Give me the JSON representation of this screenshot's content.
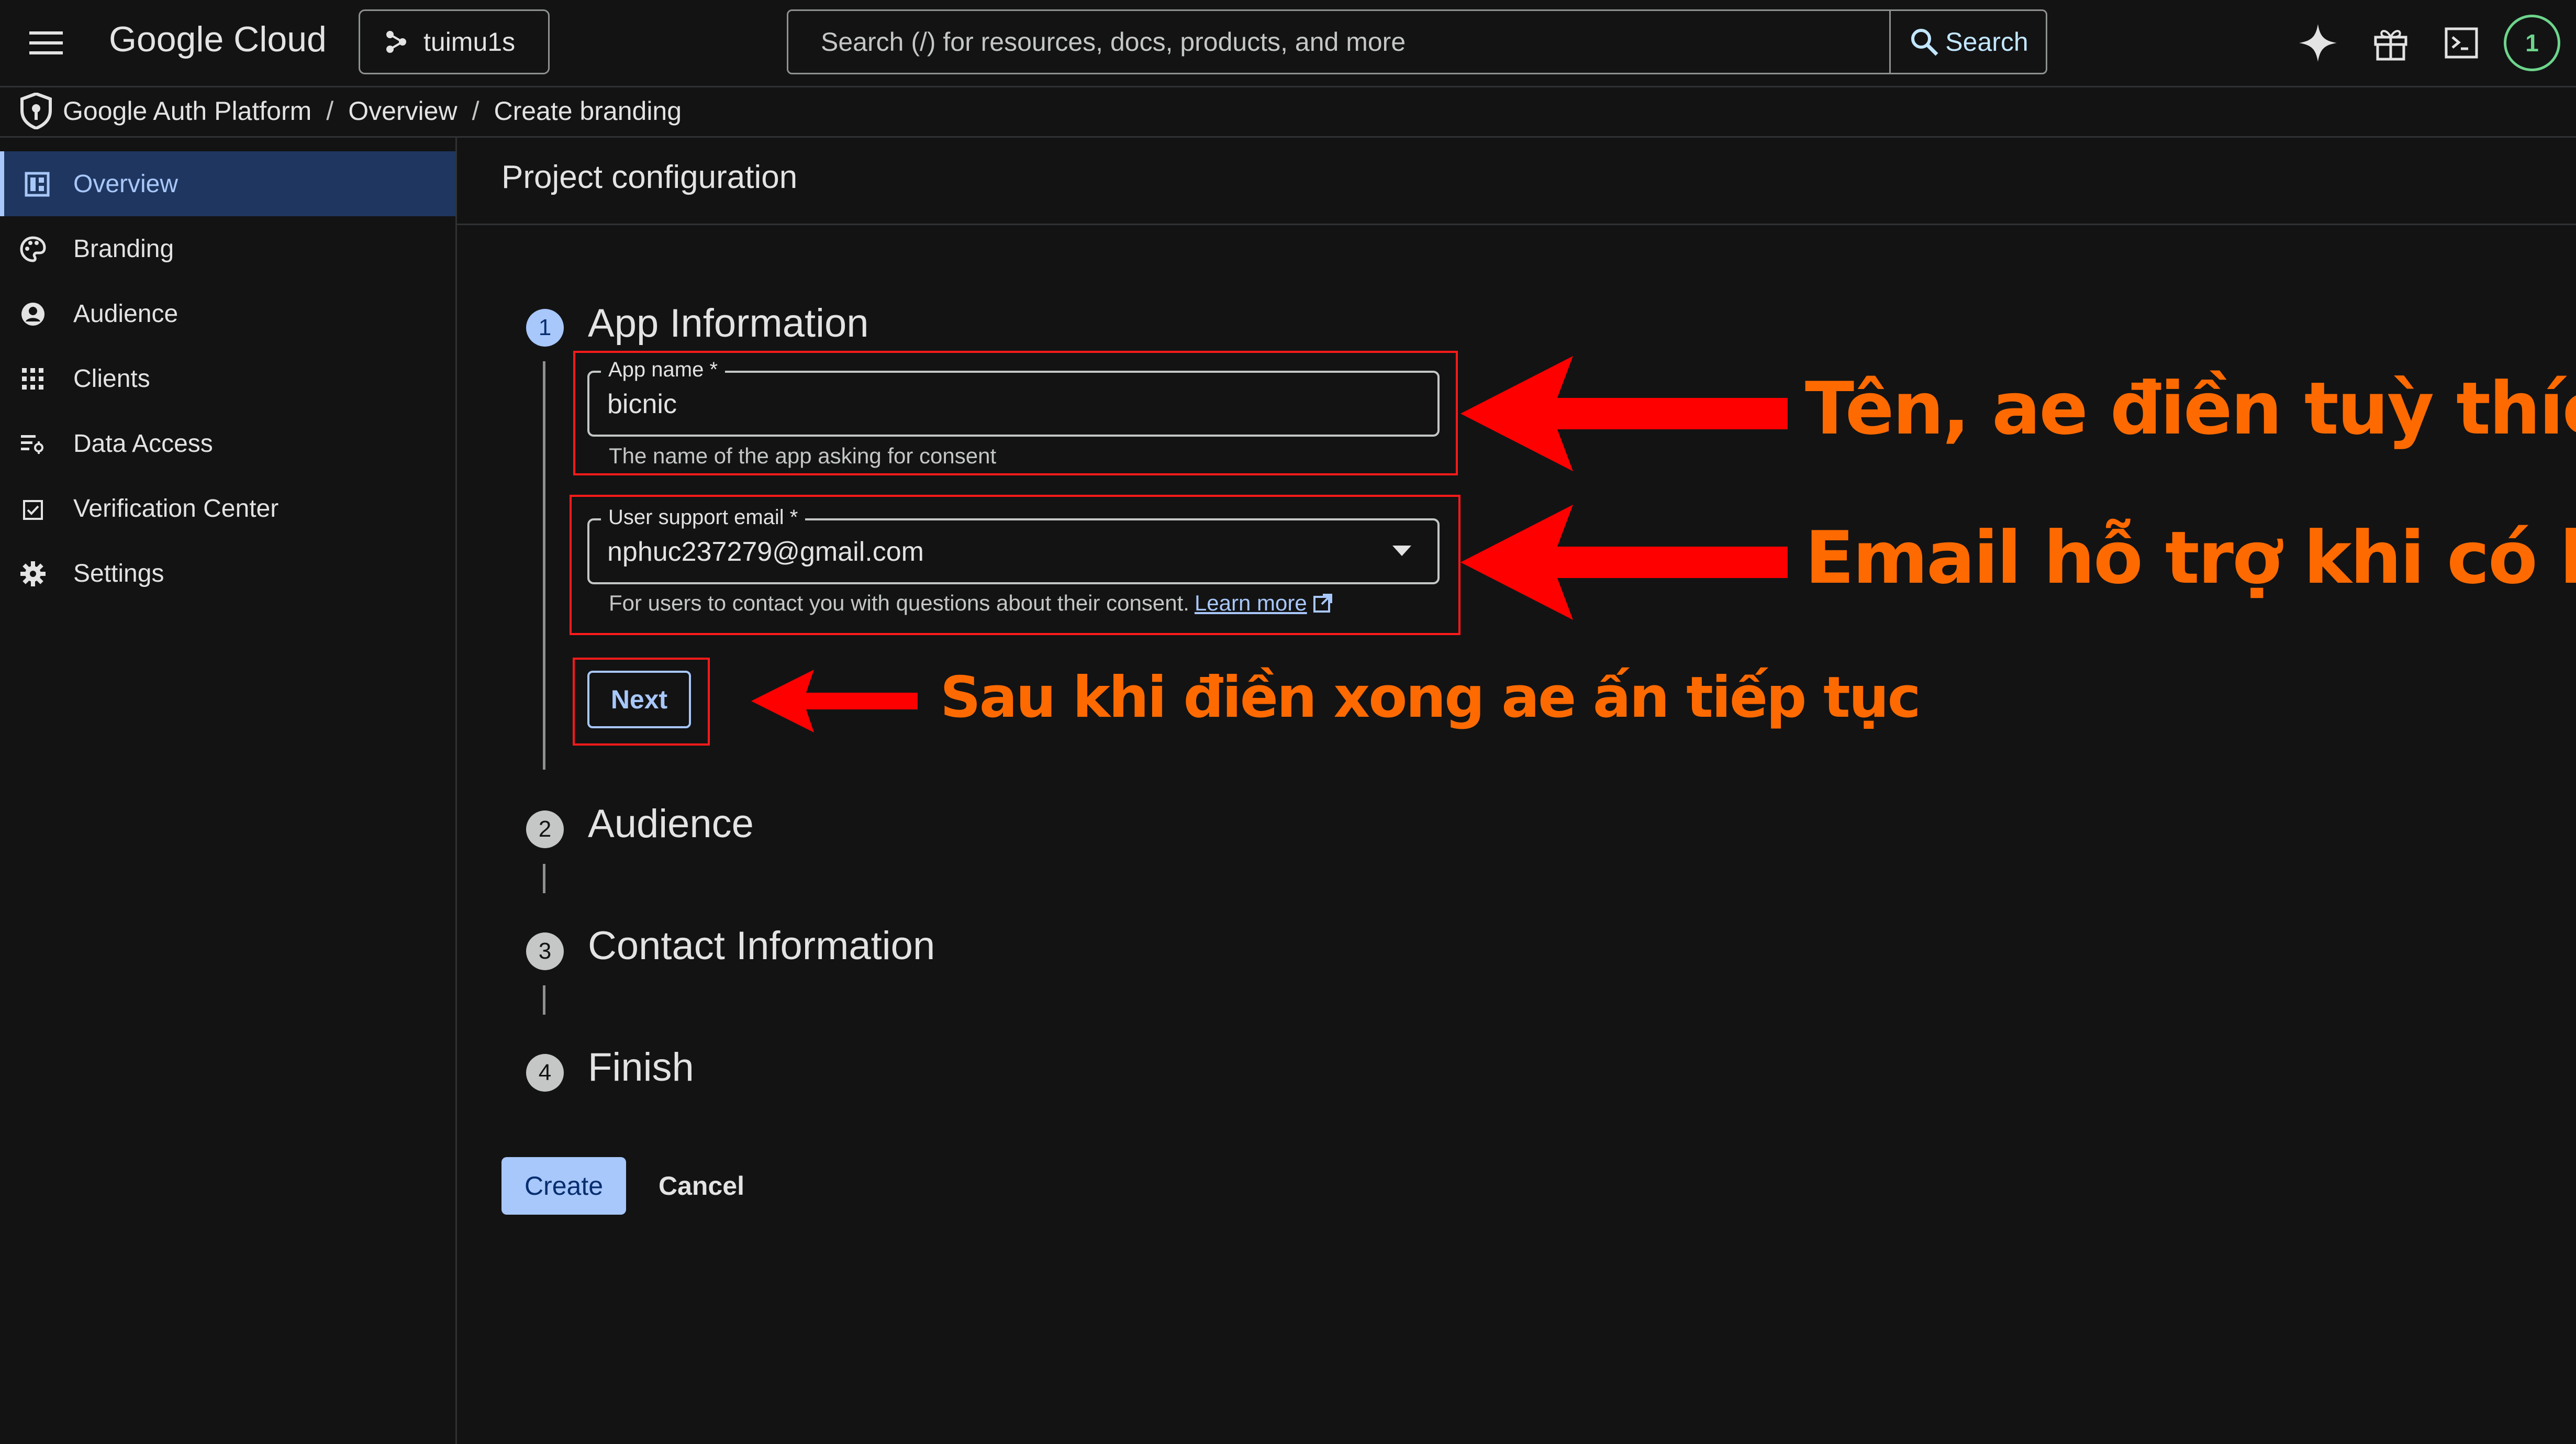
{
  "topbar": {
    "brand": "Google Cloud",
    "project": "tuimu1s",
    "search_placeholder": "Search (/) for resources, docs, products, and more",
    "search_button": "Search",
    "notification_count": "1"
  },
  "breadcrumb": {
    "items": [
      "Google Auth Platform",
      "Overview",
      "Create branding"
    ],
    "separator": "/"
  },
  "sidebar": {
    "items": [
      {
        "label": "Overview",
        "icon": "dashboard-icon",
        "active": true
      },
      {
        "label": "Branding",
        "icon": "palette-icon"
      },
      {
        "label": "Audience",
        "icon": "person-icon"
      },
      {
        "label": "Clients",
        "icon": "grid-icon"
      },
      {
        "label": "Data Access",
        "icon": "data-access-icon"
      },
      {
        "label": "Verification Center",
        "icon": "verified-icon"
      },
      {
        "label": "Settings",
        "icon": "gear-icon"
      }
    ]
  },
  "main": {
    "title": "Project configuration",
    "steps": [
      {
        "number": "1",
        "title": "App Information"
      },
      {
        "number": "2",
        "title": "Audience"
      },
      {
        "number": "3",
        "title": "Contact Information"
      },
      {
        "number": "4",
        "title": "Finish"
      }
    ],
    "app_name": {
      "label": "App name *",
      "value": "bicnic",
      "helper": "The name of the app asking for consent"
    },
    "support_email": {
      "label": "User support email *",
      "value": "nphuc237279@gmail.com",
      "helper": "For users to contact you with questions about their consent.",
      "learn_more": "Learn more"
    },
    "next_button": "Next",
    "create_button": "Create",
    "cancel_button": "Cancel"
  },
  "annotations": {
    "name_note": "Tên, ae điền tuỳ thích",
    "email_note": "Email hỗ trợ khi có lỗi",
    "next_note": "Sau khi điền xong ae ấn tiếp tục",
    "color": "#ff6a00",
    "arrow_color": "#ff0000"
  },
  "colors": {
    "background": "#131314",
    "accent": "#a8c7fa",
    "active_nav_bg": "#1f3760",
    "highlight_box": "#ff1a1a"
  }
}
